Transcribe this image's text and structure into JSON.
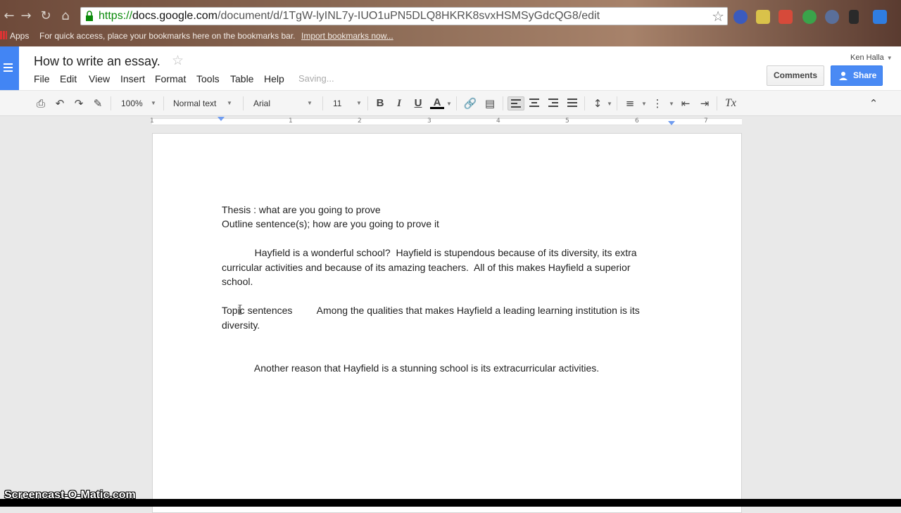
{
  "browser": {
    "url_scheme": "https://",
    "url_host": "docs.google.com",
    "url_path": "/document/d/1TgW-lyINL7y-IUO1uPN5DLQ8HKRK8svxHSMSyGdcQG8/edit",
    "bookmarks": {
      "apps_label": "Apps",
      "hint": "For quick access, place your bookmarks here on the bookmarks bar.",
      "import_link": "Import bookmarks now..."
    }
  },
  "docs": {
    "title": "How to write an essay.",
    "menus": [
      "File",
      "Edit",
      "View",
      "Insert",
      "Format",
      "Tools",
      "Table",
      "Help"
    ],
    "saving_status": "Saving...",
    "user_name": "Ken Halla",
    "comments_label": "Comments",
    "share_label": "Share"
  },
  "toolbar": {
    "zoom": "100%",
    "style": "Normal text",
    "font": "Arial",
    "size": "11",
    "bold": "B",
    "italic": "I",
    "underline": "U",
    "text_color": "A",
    "clear_formatting": "Tx"
  },
  "ruler": {
    "ticks": [
      "1",
      "1",
      "2",
      "3",
      "4",
      "5",
      "6",
      "7"
    ]
  },
  "document": {
    "lines": [
      "Thesis : what are you going to prove",
      "Outline sentence(s); how are you going to prove it",
      "            Hayfield is a wonderful school?  Hayfield is stupendous because of its diversity, its extra",
      "curricular activities and because of its amazing teachers.  All of this makes Hayfield a superior",
      "school.",
      "Topic sentences         Among the qualities that makes Hayfield a leading learning institution is its",
      "diversity.",
      "            Another reason that Hayfield is a stunning school is its extracurricular activities."
    ]
  },
  "watermark": "Screencast-O-Matic.com",
  "colors": {
    "docs_blue": "#4285f4",
    "share_blue": "#4a8af4",
    "url_green": "#0a8a0a"
  }
}
